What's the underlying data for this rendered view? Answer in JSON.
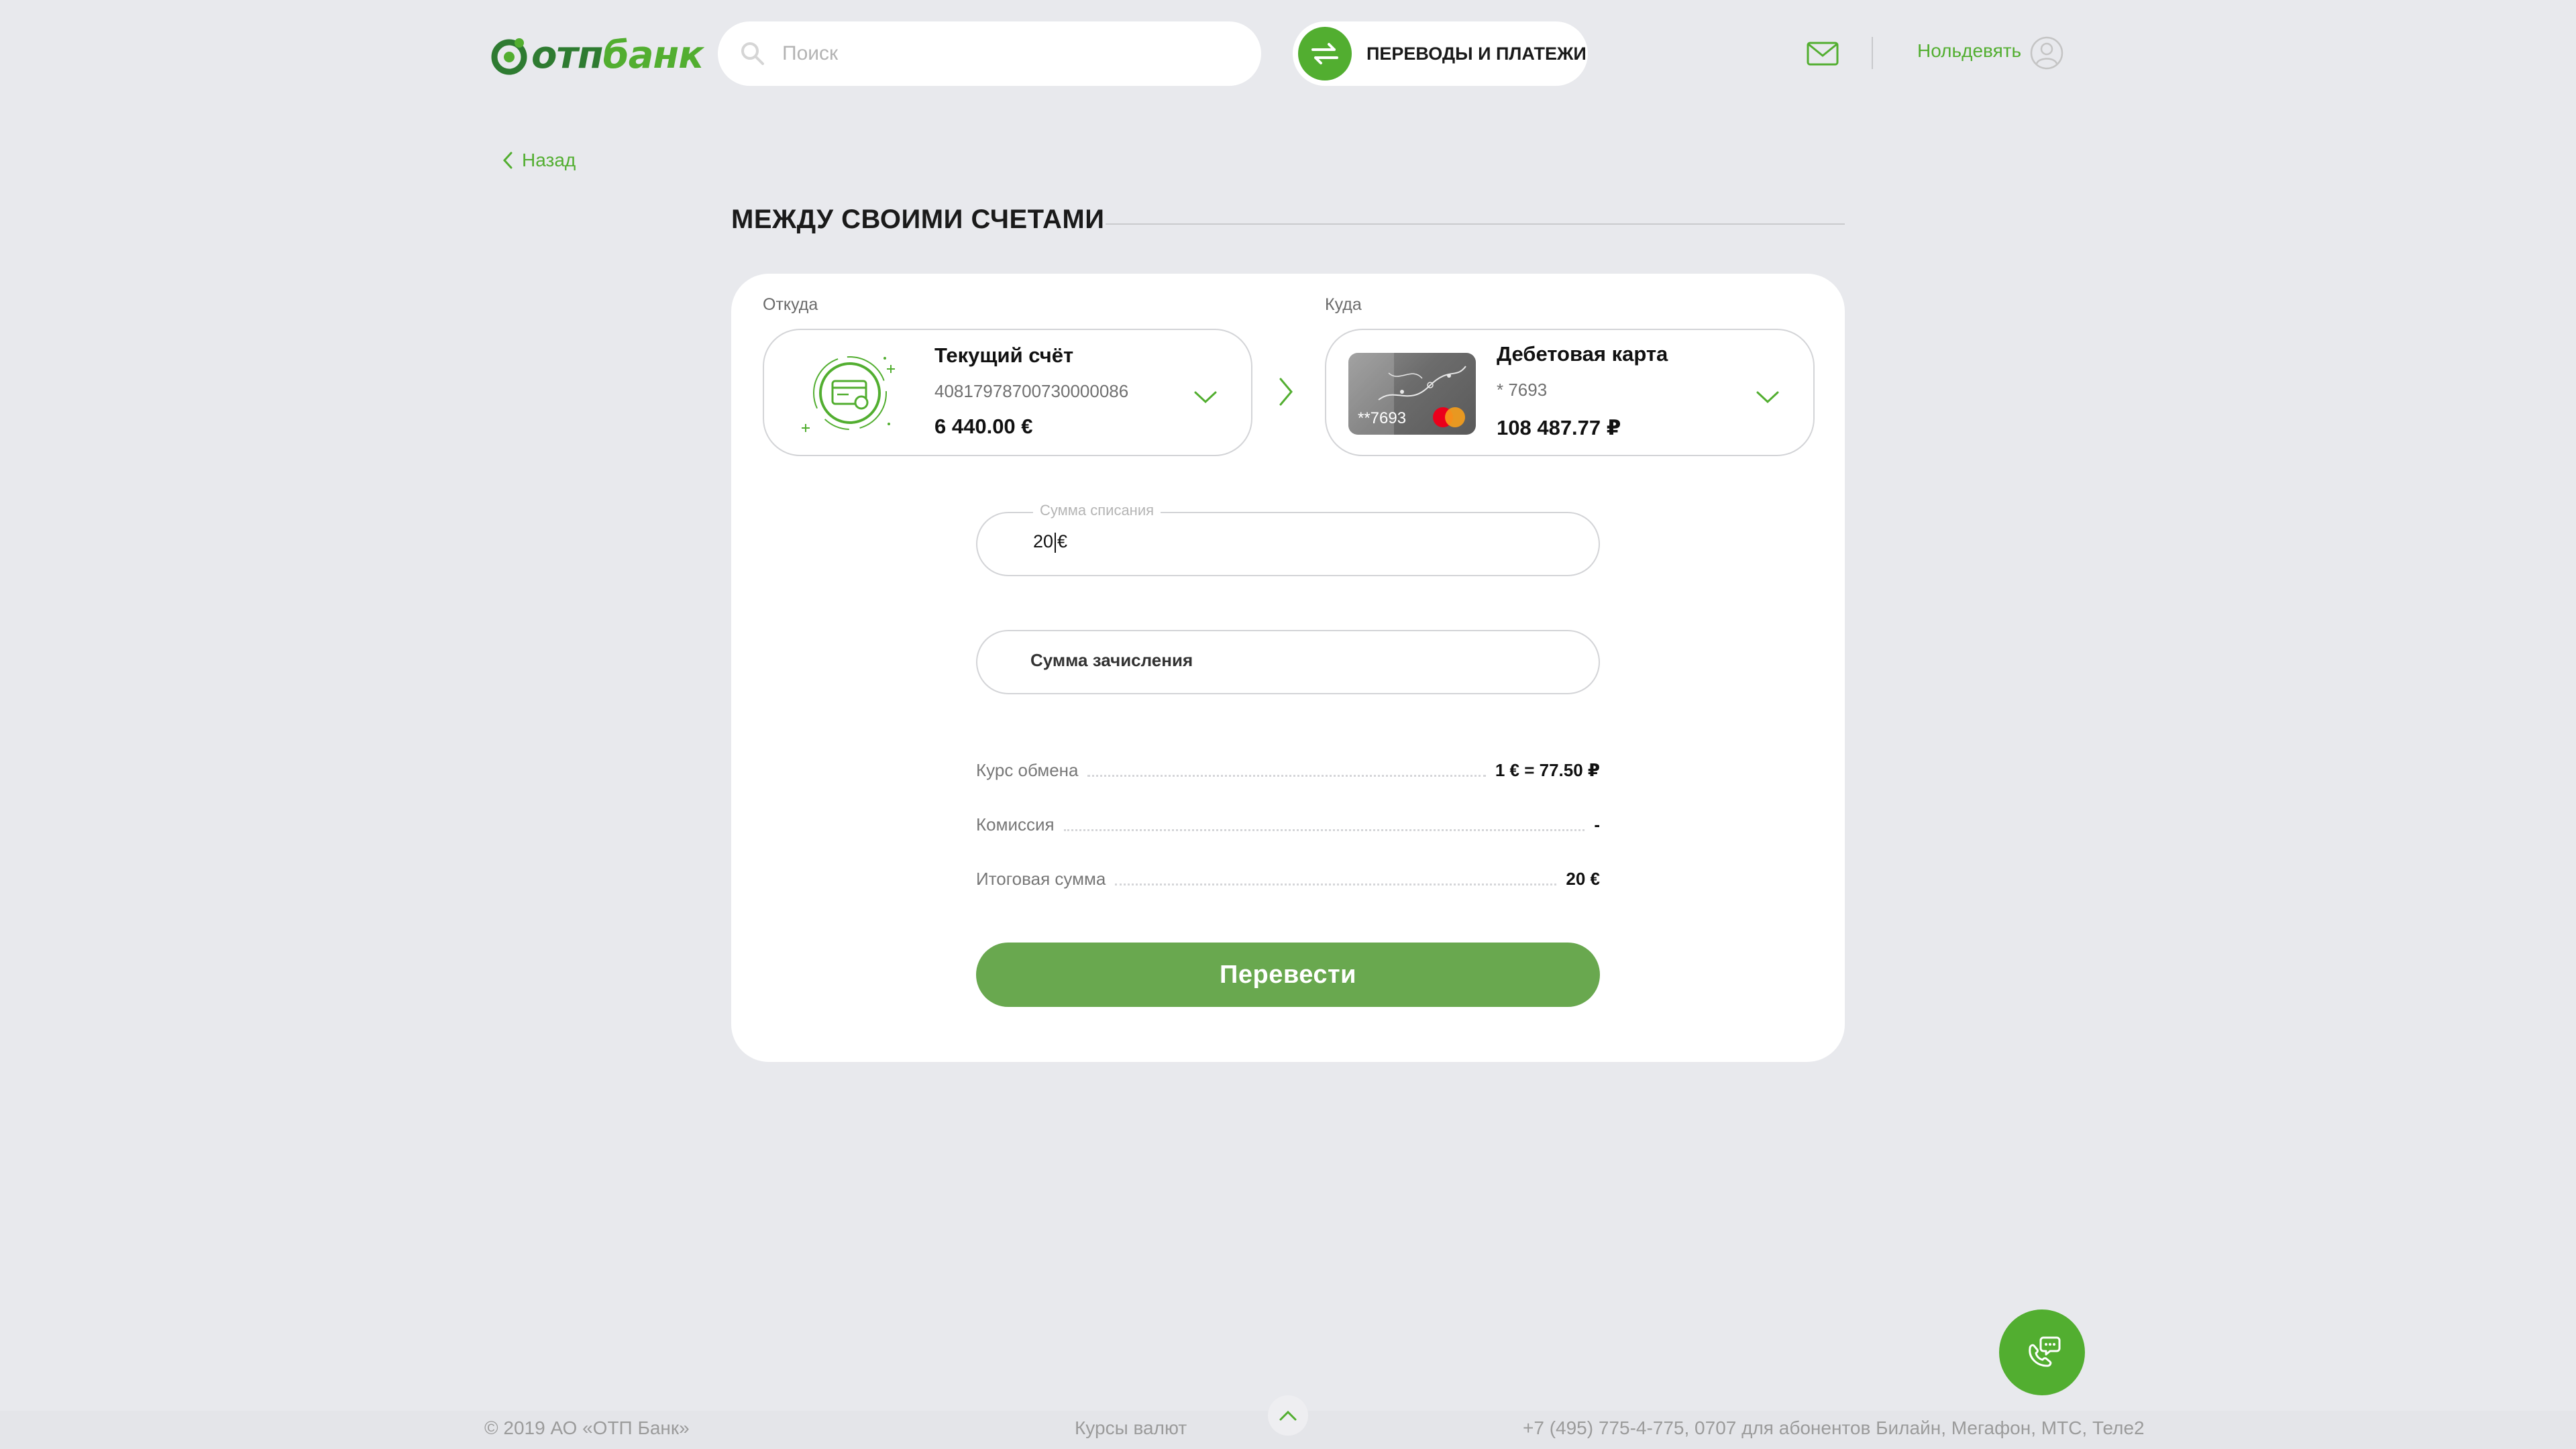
{
  "header": {
    "logo_text_dark": "отп",
    "logo_text_light": "банк",
    "search_placeholder": "Поиск",
    "transfers_label": "ПЕРЕВОДЫ И ПЛАТЕЖИ",
    "user_name": "Нольдевять"
  },
  "nav": {
    "back_label": "Назад"
  },
  "page": {
    "title": "МЕЖДУ СВОИМИ СЧЕТАМИ"
  },
  "from": {
    "caption": "Откуда",
    "title": "Текущий счёт",
    "number": "40817978700730000086",
    "balance": "6 440.00 €"
  },
  "to": {
    "caption": "Куда",
    "title": "Дебетовая карта",
    "number": "* 7693",
    "card_number": "**7693",
    "balance": "108 487.77 ₽"
  },
  "debit": {
    "label": "Сумма списания",
    "value": "20",
    "currency": "€"
  },
  "credit": {
    "placeholder": "Сумма зачисления"
  },
  "summary": [
    {
      "label": "Курс обмена",
      "value": "1 € = 77.50 ₽"
    },
    {
      "label": "Комиссия",
      "value": "-"
    },
    {
      "label": "Итоговая сумма",
      "value": "20 €"
    }
  ],
  "submit_label": "Перевести",
  "footer": {
    "copyright": "© 2019 АО «ОТП Банк»",
    "rates_link": "Курсы валют",
    "contacts": "+7 (495) 775-4-775,  0707 для абонентов Билайн, Мегафон, МТС, Теле2"
  },
  "colors": {
    "brand": "#52ae30",
    "button": "#69a84f",
    "background": "#e8e9ed"
  }
}
